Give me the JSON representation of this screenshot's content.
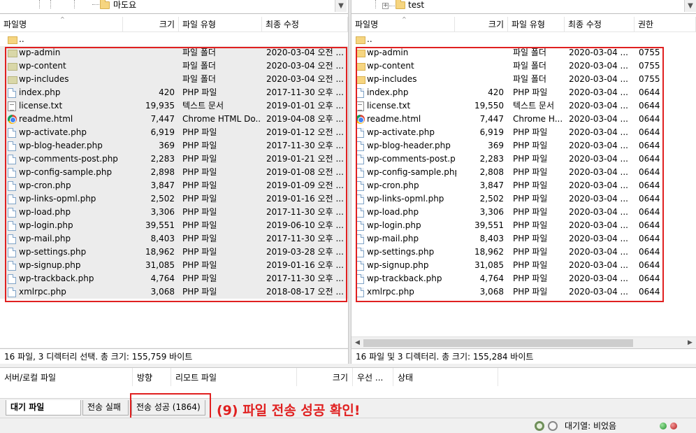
{
  "local": {
    "tree_label": "마도요",
    "headers": {
      "name": "파일명",
      "size": "크기",
      "type": "파일 유형",
      "modified": "최종 수정"
    },
    "parent": "..",
    "rows": [
      {
        "name": "wp-admin",
        "size": "",
        "type": "파일 폴더",
        "modified": "2020-03-04 오전 ...",
        "icon": "folder-icon"
      },
      {
        "name": "wp-content",
        "size": "",
        "type": "파일 폴더",
        "modified": "2020-03-04 오전 ...",
        "icon": "folder-icon"
      },
      {
        "name": "wp-includes",
        "size": "",
        "type": "파일 폴더",
        "modified": "2020-03-04 오전 ...",
        "icon": "folder-icon"
      },
      {
        "name": "index.php",
        "size": "420",
        "type": "PHP 파일",
        "modified": "2017-11-30 오후 ...",
        "icon": "file-icon"
      },
      {
        "name": "license.txt",
        "size": "19,935",
        "type": "텍스트 문서",
        "modified": "2019-01-01 오후 ...",
        "icon": "text-file-icon"
      },
      {
        "name": "readme.html",
        "size": "7,447",
        "type": "Chrome HTML Do...",
        "modified": "2019-04-08 오후 ...",
        "icon": "chrome-icon"
      },
      {
        "name": "wp-activate.php",
        "size": "6,919",
        "type": "PHP 파일",
        "modified": "2019-01-12 오전 ...",
        "icon": "file-icon"
      },
      {
        "name": "wp-blog-header.php",
        "size": "369",
        "type": "PHP 파일",
        "modified": "2017-11-30 오후 ...",
        "icon": "file-icon"
      },
      {
        "name": "wp-comments-post.php",
        "size": "2,283",
        "type": "PHP 파일",
        "modified": "2019-01-21 오전 ...",
        "icon": "file-icon"
      },
      {
        "name": "wp-config-sample.php",
        "size": "2,898",
        "type": "PHP 파일",
        "modified": "2019-01-08 오전 ...",
        "icon": "file-icon"
      },
      {
        "name": "wp-cron.php",
        "size": "3,847",
        "type": "PHP 파일",
        "modified": "2019-01-09 오전 ...",
        "icon": "file-icon"
      },
      {
        "name": "wp-links-opml.php",
        "size": "2,502",
        "type": "PHP 파일",
        "modified": "2019-01-16 오전 ...",
        "icon": "file-icon"
      },
      {
        "name": "wp-load.php",
        "size": "3,306",
        "type": "PHP 파일",
        "modified": "2017-11-30 오후 ...",
        "icon": "file-icon"
      },
      {
        "name": "wp-login.php",
        "size": "39,551",
        "type": "PHP 파일",
        "modified": "2019-06-10 오후 ...",
        "icon": "file-icon"
      },
      {
        "name": "wp-mail.php",
        "size": "8,403",
        "type": "PHP 파일",
        "modified": "2017-11-30 오후 ...",
        "icon": "file-icon"
      },
      {
        "name": "wp-settings.php",
        "size": "18,962",
        "type": "PHP 파일",
        "modified": "2019-03-28 오후 ...",
        "icon": "file-icon"
      },
      {
        "name": "wp-signup.php",
        "size": "31,085",
        "type": "PHP 파일",
        "modified": "2019-01-16 오후 ...",
        "icon": "file-icon"
      },
      {
        "name": "wp-trackback.php",
        "size": "4,764",
        "type": "PHP 파일",
        "modified": "2017-11-30 오후 ...",
        "icon": "file-icon"
      },
      {
        "name": "xmlrpc.php",
        "size": "3,068",
        "type": "PHP 파일",
        "modified": "2018-08-17 오전 ...",
        "icon": "file-icon"
      }
    ],
    "status": "16 파일, 3 디렉터리 선택. 총 크기: 155,759 바이트"
  },
  "remote": {
    "tree_label": "test",
    "headers": {
      "name": "파일명",
      "size": "크기",
      "type": "파일 유형",
      "modified": "최종 수정",
      "perms": "권한"
    },
    "parent": "..",
    "rows": [
      {
        "name": "wp-admin",
        "size": "",
        "type": "파일 폴더",
        "modified": "2020-03-04 ...",
        "perms": "0755",
        "icon": "folder-icon"
      },
      {
        "name": "wp-content",
        "size": "",
        "type": "파일 폴더",
        "modified": "2020-03-04 ...",
        "perms": "0755",
        "icon": "folder-icon"
      },
      {
        "name": "wp-includes",
        "size": "",
        "type": "파일 폴더",
        "modified": "2020-03-04 ...",
        "perms": "0755",
        "icon": "folder-icon"
      },
      {
        "name": "index.php",
        "size": "420",
        "type": "PHP 파일",
        "modified": "2020-03-04 ...",
        "perms": "0644",
        "icon": "file-icon"
      },
      {
        "name": "license.txt",
        "size": "19,550",
        "type": "텍스트 문서",
        "modified": "2020-03-04 ...",
        "perms": "0644",
        "icon": "text-file-icon"
      },
      {
        "name": "readme.html",
        "size": "7,447",
        "type": "Chrome H...",
        "modified": "2020-03-04 ...",
        "perms": "0644",
        "icon": "chrome-icon"
      },
      {
        "name": "wp-activate.php",
        "size": "6,919",
        "type": "PHP 파일",
        "modified": "2020-03-04 ...",
        "perms": "0644",
        "icon": "file-icon"
      },
      {
        "name": "wp-blog-header.php",
        "size": "369",
        "type": "PHP 파일",
        "modified": "2020-03-04 ...",
        "perms": "0644",
        "icon": "file-icon"
      },
      {
        "name": "wp-comments-post.p...",
        "size": "2,283",
        "type": "PHP 파일",
        "modified": "2020-03-04 ...",
        "perms": "0644",
        "icon": "file-icon"
      },
      {
        "name": "wp-config-sample.php",
        "size": "2,808",
        "type": "PHP 파일",
        "modified": "2020-03-04 ...",
        "perms": "0644",
        "icon": "file-icon"
      },
      {
        "name": "wp-cron.php",
        "size": "3,847",
        "type": "PHP 파일",
        "modified": "2020-03-04 ...",
        "perms": "0644",
        "icon": "file-icon"
      },
      {
        "name": "wp-links-opml.php",
        "size": "2,502",
        "type": "PHP 파일",
        "modified": "2020-03-04 ...",
        "perms": "0644",
        "icon": "file-icon"
      },
      {
        "name": "wp-load.php",
        "size": "3,306",
        "type": "PHP 파일",
        "modified": "2020-03-04 ...",
        "perms": "0644",
        "icon": "file-icon"
      },
      {
        "name": "wp-login.php",
        "size": "39,551",
        "type": "PHP 파일",
        "modified": "2020-03-04 ...",
        "perms": "0644",
        "icon": "file-icon"
      },
      {
        "name": "wp-mail.php",
        "size": "8,403",
        "type": "PHP 파일",
        "modified": "2020-03-04 ...",
        "perms": "0644",
        "icon": "file-icon"
      },
      {
        "name": "wp-settings.php",
        "size": "18,962",
        "type": "PHP 파일",
        "modified": "2020-03-04 ...",
        "perms": "0644",
        "icon": "file-icon"
      },
      {
        "name": "wp-signup.php",
        "size": "31,085",
        "type": "PHP 파일",
        "modified": "2020-03-04 ...",
        "perms": "0644",
        "icon": "file-icon"
      },
      {
        "name": "wp-trackback.php",
        "size": "4,764",
        "type": "PHP 파일",
        "modified": "2020-03-04 ...",
        "perms": "0644",
        "icon": "file-icon"
      },
      {
        "name": "xmlrpc.php",
        "size": "3,068",
        "type": "PHP 파일",
        "modified": "2020-03-04 ...",
        "perms": "0644",
        "icon": "file-icon"
      }
    ],
    "status": "16 파일 및 3 디렉터리. 총 크기: 155,284 바이트"
  },
  "queue": {
    "columns": [
      "서버/로컬 파일",
      "방향",
      "리모트 파일",
      "크기",
      "우선 ...",
      "상태"
    ]
  },
  "tabs": [
    {
      "label": "대기 파일",
      "active": true
    },
    {
      "label": "전송 실패",
      "active": false
    },
    {
      "label": "전송 성공 (1864)",
      "active": false
    }
  ],
  "annotation": "(9) 파일 전송 성공 확인!",
  "status_bar": {
    "queue_status": "대기열: 비었음"
  },
  "colors": {
    "annotation_red": "#e02020",
    "selection_gray": "#ececec"
  }
}
